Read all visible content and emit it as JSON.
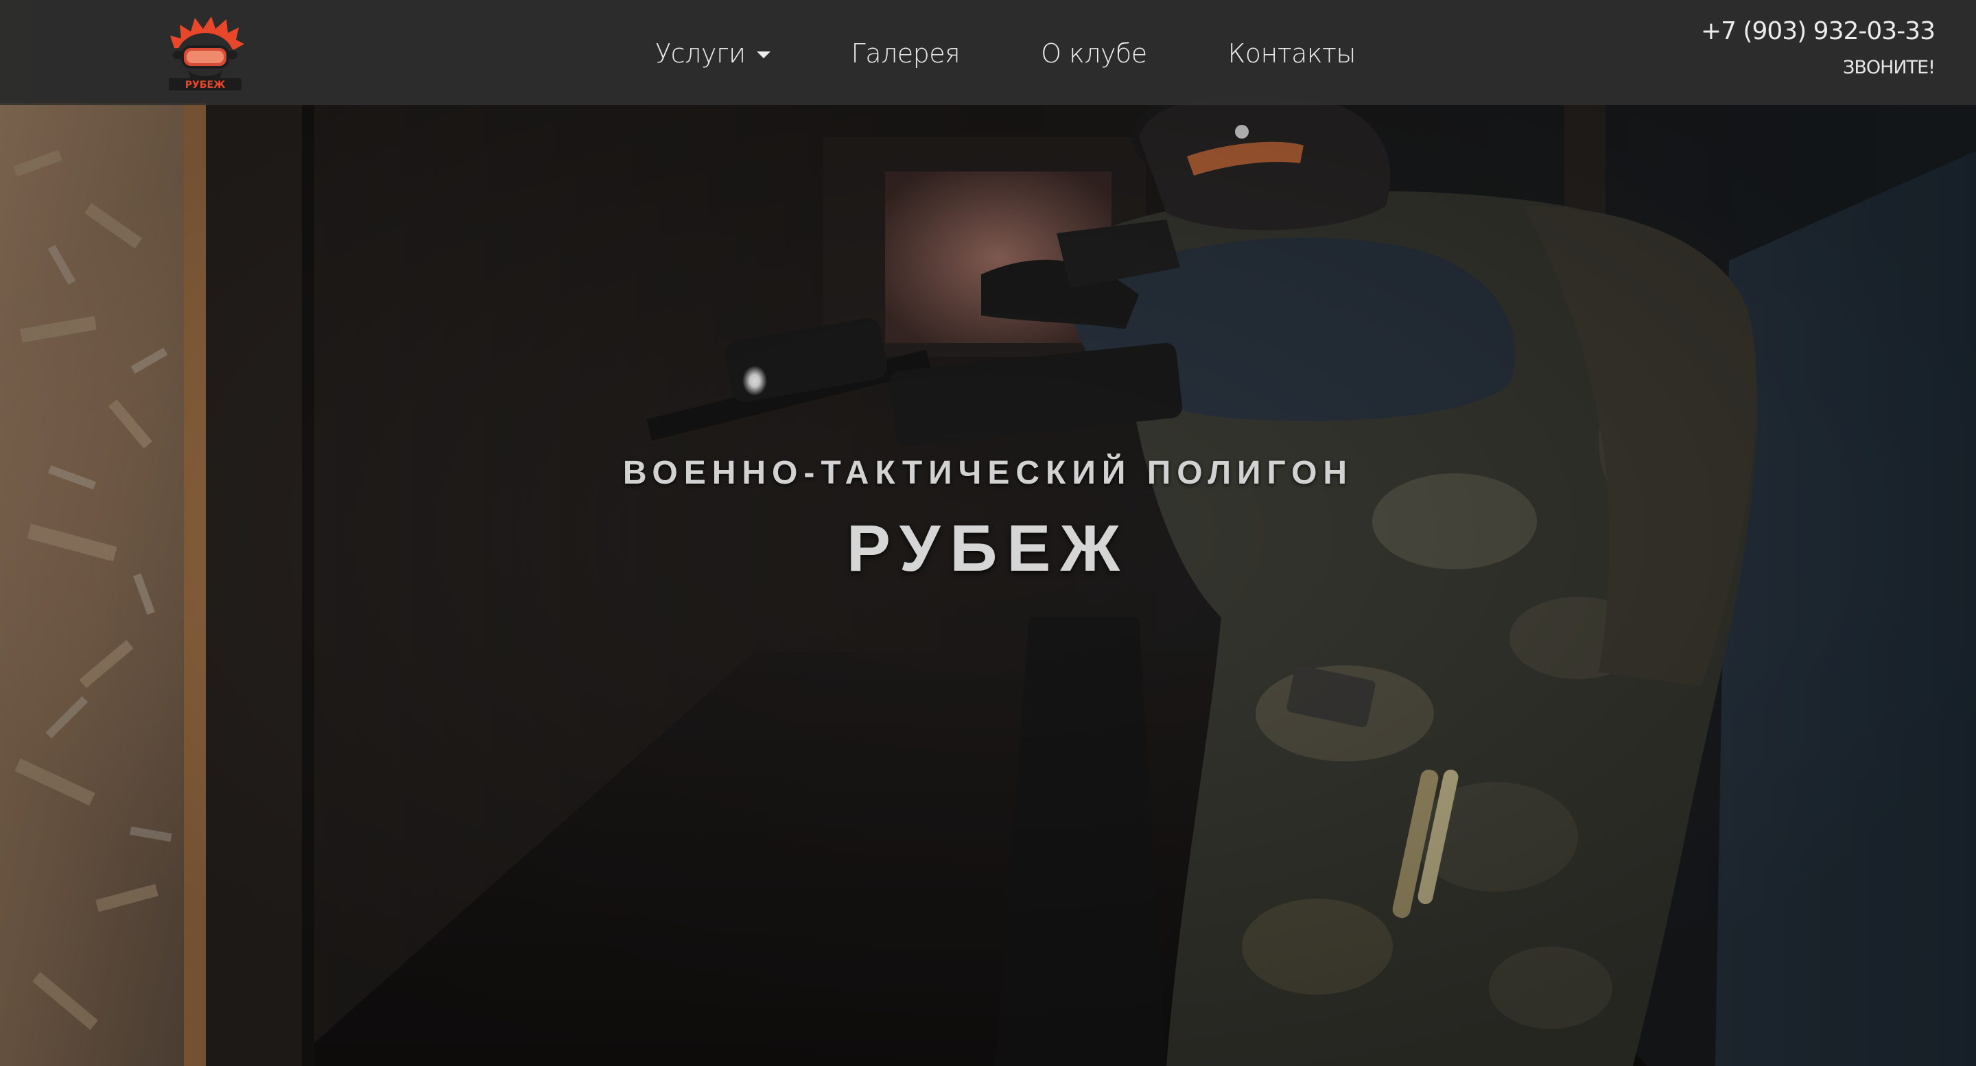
{
  "header": {
    "logo_text": "РУБЕЖ",
    "nav": [
      {
        "label": "Услуги",
        "has_dropdown": true
      },
      {
        "label": "Галерея"
      },
      {
        "label": "О клубе"
      },
      {
        "label": "Контакты"
      }
    ],
    "phone": "+7 (903) 932-03-33",
    "call_label": "ЗВОНИТЕ!"
  },
  "hero": {
    "subtitle": "ВОЕННО-ТАКТИЧЕСКИЙ ПОЛИГОН",
    "title": "РУБЕЖ"
  },
  "colors": {
    "header_bg": "#303030",
    "nav_text": "#ececec",
    "hero_text": "#d4d4d4",
    "logo_accent": "#e8472a"
  }
}
